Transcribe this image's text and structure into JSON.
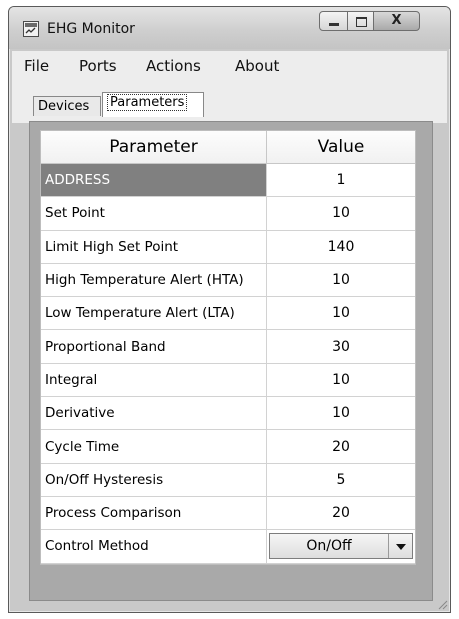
{
  "window": {
    "title": "EHG Monitor"
  },
  "title_controls": {
    "minimize_icon": "minimize-icon",
    "maximize_icon": "maximize-icon",
    "close_glyph": "X"
  },
  "menu": [
    "File",
    "Ports",
    "Actions",
    "About"
  ],
  "tabs": [
    {
      "label": "Devices",
      "active": false
    },
    {
      "label": "Parameters",
      "active": true
    }
  ],
  "table": {
    "headers": [
      "Parameter",
      "Value"
    ],
    "rows": [
      {
        "name": "ADDRESS",
        "value": "1",
        "selected": true
      },
      {
        "name": "Set Point",
        "value": "10"
      },
      {
        "name": "Limit High Set Point",
        "value": "140"
      },
      {
        "name": "High Temperature Alert (HTA)",
        "value": "10"
      },
      {
        "name": "Low Temperature Alert (LTA)",
        "value": "10"
      },
      {
        "name": "Proportional Band",
        "value": "30"
      },
      {
        "name": "Integral",
        "value": "10"
      },
      {
        "name": "Derivative",
        "value": "10"
      },
      {
        "name": "Cycle Time",
        "value": "20"
      },
      {
        "name": "On/Off Hysteresis",
        "value": "5"
      },
      {
        "name": "Process Comparison",
        "value": "20"
      },
      {
        "name": "Control Method",
        "value": "On/Off",
        "dropdown": true
      }
    ]
  },
  "colors": {
    "selected_row": "#808080",
    "panel": "#a9a9a9",
    "chrome": "#ededed"
  }
}
